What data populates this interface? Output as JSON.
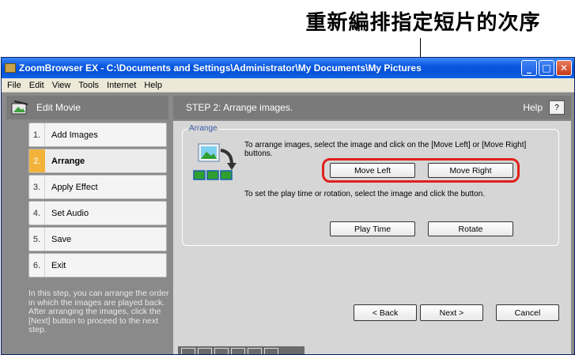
{
  "annotation": {
    "title": "重新編排指定短片的次序"
  },
  "window": {
    "title": "ZoomBrowser EX  -  C:\\Documents and Settings\\Administrator\\My Documents\\My Pictures",
    "min_label": "_",
    "max_label": "□",
    "close_label": "✕"
  },
  "menu": {
    "items": [
      "File",
      "Edit",
      "View",
      "Tools",
      "Internet",
      "Help"
    ]
  },
  "sidebar": {
    "header": "Edit Movie",
    "steps": [
      {
        "num": "1.",
        "label": "Add Images"
      },
      {
        "num": "2.",
        "label": "Arrange"
      },
      {
        "num": "3.",
        "label": "Apply Effect"
      },
      {
        "num": "4.",
        "label": "Set Audio"
      },
      {
        "num": "5.",
        "label": "Save"
      },
      {
        "num": "6.",
        "label": "Exit"
      }
    ],
    "description": "In this step, you can arrange the order in which the images are played back.\n After arranging the images, click the [Next] button to proceed to the next step."
  },
  "main": {
    "header": "STEP 2: Arrange images.",
    "help_label": "Help",
    "help_button": "?",
    "arrange_legend": "Arrange",
    "instruction_move": "To arrange images, select the image and click on the [Move Left] or [Move Right] buttons.",
    "instruction_play": "To set the play time or rotation, select the image and click the button.",
    "move_left": "Move Left",
    "move_right": "Move Right",
    "play_time": "Play Time",
    "rotate": "Rotate",
    "back": "< Back",
    "next": "Next >",
    "cancel": "Cancel"
  },
  "colors": {
    "highlight": "#e0201c",
    "active_step_number": "#f3b33b"
  }
}
